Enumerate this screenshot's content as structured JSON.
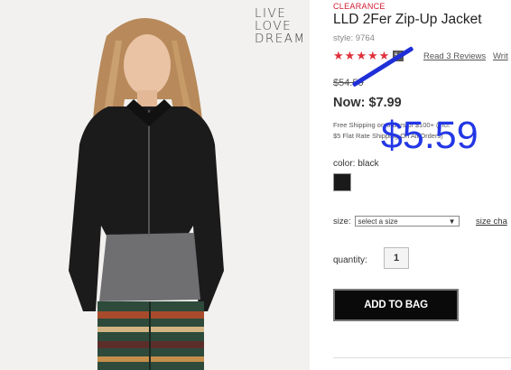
{
  "photo": {
    "brand_lines": [
      "LIVE",
      "LOVE",
      "DREAM"
    ]
  },
  "product": {
    "badge": "CLEARANCE",
    "title": "LLD 2Fer Zip-Up Jacket",
    "style": "style: 9764",
    "rating": {
      "stars": 5,
      "max": 5,
      "badge": "5.0"
    },
    "reviews_link": "Read 3 Reviews",
    "write_link": "Writ",
    "old_price": "$54.50",
    "now_label": "Now: $7.99",
    "shipping_line1": "Free Shipping on orders of $100+ (incl.",
    "shipping_line2": "$5 Flat Rate Shipping On All Orders)",
    "new_price_overlay": "$5.59",
    "color_label": "color: black",
    "color_swatch": "#1a1a1a",
    "size_label": "size:",
    "size_placeholder": "select a size",
    "size_chart_link": "size cha",
    "quantity_label": "quantity:",
    "quantity_value": "1",
    "add_to_bag": "ADD TO BAG"
  },
  "colors": {
    "clearance_red": "#d21b30",
    "star_red": "#e0303b",
    "overlay_blue": "#2337e6"
  }
}
